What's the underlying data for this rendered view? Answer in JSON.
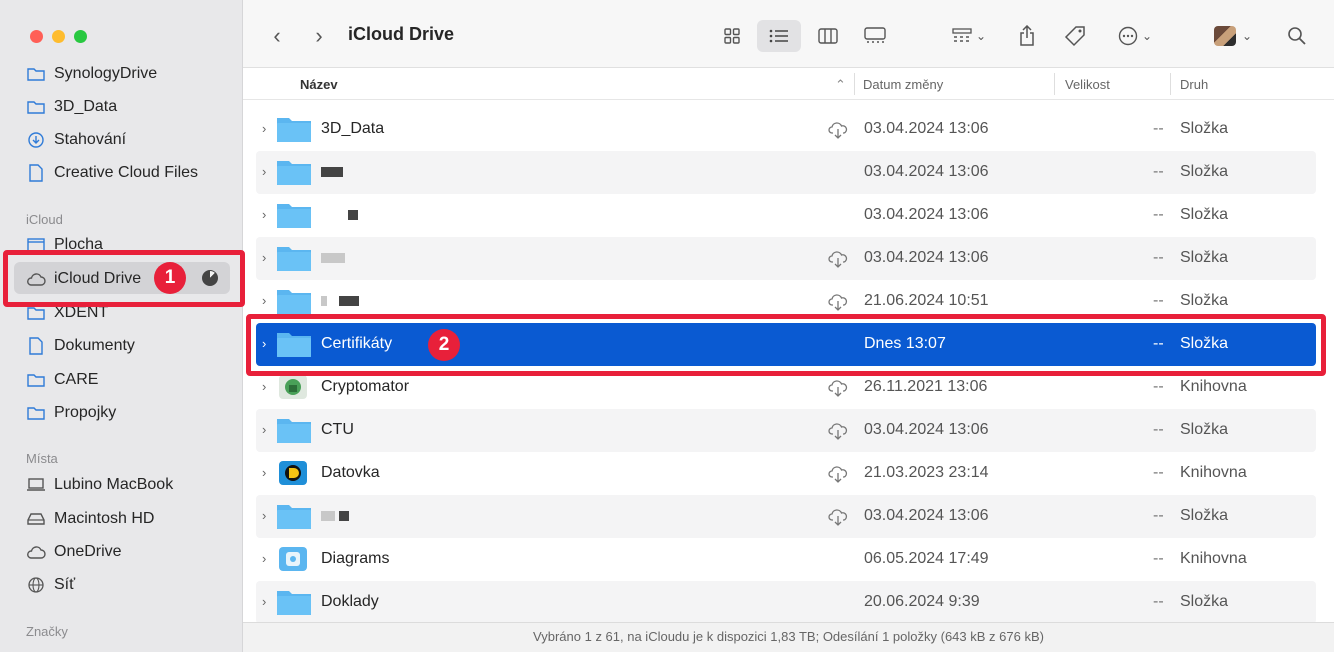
{
  "window": {
    "title": "iCloud Drive"
  },
  "sidebar": {
    "items_top": [
      {
        "label": "SynologyDrive",
        "icon": "folder-icon"
      },
      {
        "label": "3D_Data",
        "icon": "folder-icon"
      },
      {
        "label": "Stahování",
        "icon": "download-icon"
      },
      {
        "label": "Creative Cloud Files",
        "icon": "document-icon"
      }
    ],
    "section_icloud": "iCloud",
    "items_icloud": [
      {
        "label": "Plocha",
        "icon": "desktop-icon"
      },
      {
        "label": "iCloud Drive",
        "icon": "cloud-icon"
      },
      {
        "label": "XDENT",
        "icon": "folder-icon"
      },
      {
        "label": "Dokumenty",
        "icon": "document-icon"
      },
      {
        "label": "CARE",
        "icon": "folder-icon"
      },
      {
        "label": "Propojky",
        "icon": "folder-icon"
      }
    ],
    "section_places": "Místa",
    "items_places": [
      {
        "label": "Lubino MacBook",
        "icon": "laptop-icon"
      },
      {
        "label": "Macintosh HD",
        "icon": "disk-icon"
      },
      {
        "label": "OneDrive",
        "icon": "cloud-icon"
      },
      {
        "label": "Síť",
        "icon": "globe-icon"
      }
    ],
    "section_tags": "Značky"
  },
  "columns": {
    "name": "Název",
    "date": "Datum změny",
    "size": "Velikost",
    "kind": "Druh"
  },
  "rows": [
    {
      "name": "3D_Data",
      "date": "03.04.2024 13:06",
      "size": "--",
      "kind": "Složka",
      "cloud": true
    },
    {
      "name": "",
      "date": "03.04.2024 13:06",
      "size": "--",
      "kind": "Složka",
      "cloud": false
    },
    {
      "name": "",
      "date": "03.04.2024 13:06",
      "size": "--",
      "kind": "Složka",
      "cloud": false
    },
    {
      "name": "",
      "date": "03.04.2024 13:06",
      "size": "--",
      "kind": "Složka",
      "cloud": true
    },
    {
      "name": "",
      "date": "21.06.2024 10:51",
      "size": "--",
      "kind": "Složka",
      "cloud": true
    },
    {
      "name": "Certifikáty",
      "date": "Dnes 13:07",
      "size": "--",
      "kind": "Složka",
      "cloud": false
    },
    {
      "name": "Cryptomator",
      "date": "26.11.2021 13:06",
      "size": "--",
      "kind": "Knihovna",
      "cloud": true
    },
    {
      "name": "CTU",
      "date": "03.04.2024 13:06",
      "size": "--",
      "kind": "Složka",
      "cloud": true
    },
    {
      "name": "Datovka",
      "date": "21.03.2023 23:14",
      "size": "--",
      "kind": "Knihovna",
      "cloud": true
    },
    {
      "name": "",
      "date": "03.04.2024 13:06",
      "size": "--",
      "kind": "Složka",
      "cloud": true
    },
    {
      "name": "Diagrams",
      "date": "06.05.2024 17:49",
      "size": "--",
      "kind": "Knihovna",
      "cloud": false
    },
    {
      "name": "Doklady",
      "date": "20.06.2024 9:39",
      "size": "--",
      "kind": "Složka",
      "cloud": false
    }
  ],
  "status": "Vybráno 1 z 61, na iCloudu je k dispozici 1,83 TB; Odesílání 1 položky (643 kB z 676 kB)",
  "annotations": {
    "badge1": "1",
    "badge2": "2"
  },
  "colors": {
    "selection": "#0a5ad2",
    "annotation": "#e8203a",
    "folder": "#5bb6f0"
  }
}
